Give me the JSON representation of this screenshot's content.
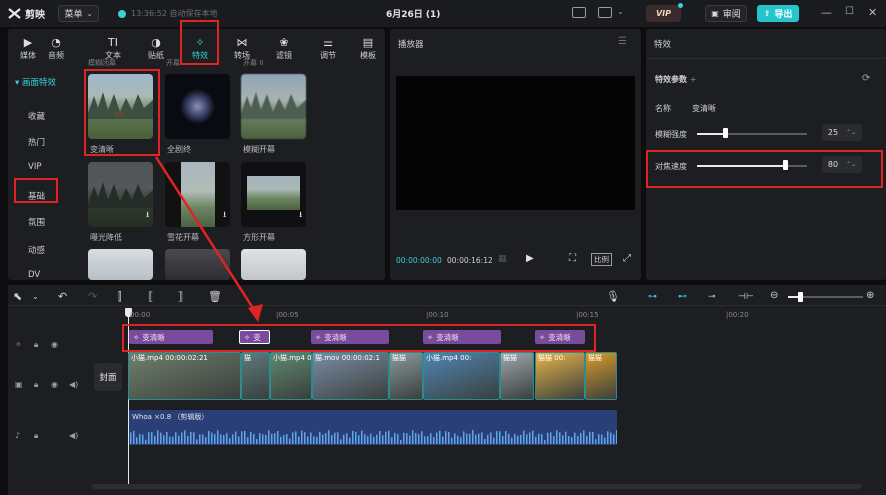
{
  "app": {
    "name": "剪映",
    "menu_label": "菜单",
    "autosave": "13:36:52 自动保存本地",
    "project_title": "6月26日 (1)",
    "vip_label": "VIP",
    "review_label": "审阅",
    "export_label": "导出"
  },
  "tabs": [
    {
      "label": "媒体",
      "icon": "media-icon"
    },
    {
      "label": "音频",
      "icon": "audio-icon"
    },
    {
      "label": "文本",
      "icon": "text-icon"
    },
    {
      "label": "贴纸",
      "icon": "sticker-icon"
    },
    {
      "label": "特效",
      "icon": "sparkle-icon",
      "active": true
    },
    {
      "label": "转场",
      "icon": "transition-icon"
    },
    {
      "label": "滤镜",
      "icon": "filter-icon"
    },
    {
      "label": "调节",
      "icon": "adjust-icon"
    },
    {
      "label": "模板",
      "icon": "template-icon"
    }
  ],
  "categories": {
    "head": "画面特效",
    "items": [
      "收藏",
      "热门",
      "VIP",
      "基础",
      "氛围",
      "动感",
      "DV"
    ],
    "selected": "基础"
  },
  "effects": [
    {
      "label": "变清晰"
    },
    {
      "label": "全剧终"
    },
    {
      "label": "模糊开幕"
    },
    {
      "label": "曝光降低"
    },
    {
      "label": "雪花开幕"
    },
    {
      "label": "方形开幕"
    }
  ],
  "effects_top_labels": [
    "模糊闭幕",
    "开幕",
    "开幕 II"
  ],
  "player": {
    "title": "播放器",
    "current_time": "00:00:00:00",
    "total_time": "00:00:16:12",
    "ratio_label": "比例"
  },
  "fx_panel": {
    "title": "特效",
    "params_title": "特效参数",
    "name_label": "名称",
    "name_value": "变清晰",
    "params": [
      {
        "label": "模糊强度",
        "value": "25",
        "level": 0.25
      },
      {
        "label": "对焦速度",
        "value": "80",
        "level": 0.8
      }
    ]
  },
  "timeline": {
    "ruler": [
      "00:00",
      "|00:05",
      "|00:10",
      "|00:15",
      "|00:20"
    ],
    "fx_clips": [
      "变清晰",
      "变",
      "变清晰",
      "变清晰",
      "变清晰"
    ],
    "video_clips": [
      "小猫.mp4  00:00:02:21",
      "猫",
      "小猫.mp4  00:00:02:",
      "猫.mov  00:00:02:1",
      "猫猫",
      "小猫.mp4  00:",
      "猫猫",
      "猫猫  00:",
      "猫猫"
    ],
    "cover_label": "封面",
    "audio_label": "Whoa ×0.8 （剪辑版）"
  },
  "colors": {
    "accent": "#39d0d8",
    "highlight": "#e02424",
    "fx_clip": "#7a4a9c",
    "audio_clip": "#2a3e78",
    "export": "#26c4cc"
  }
}
